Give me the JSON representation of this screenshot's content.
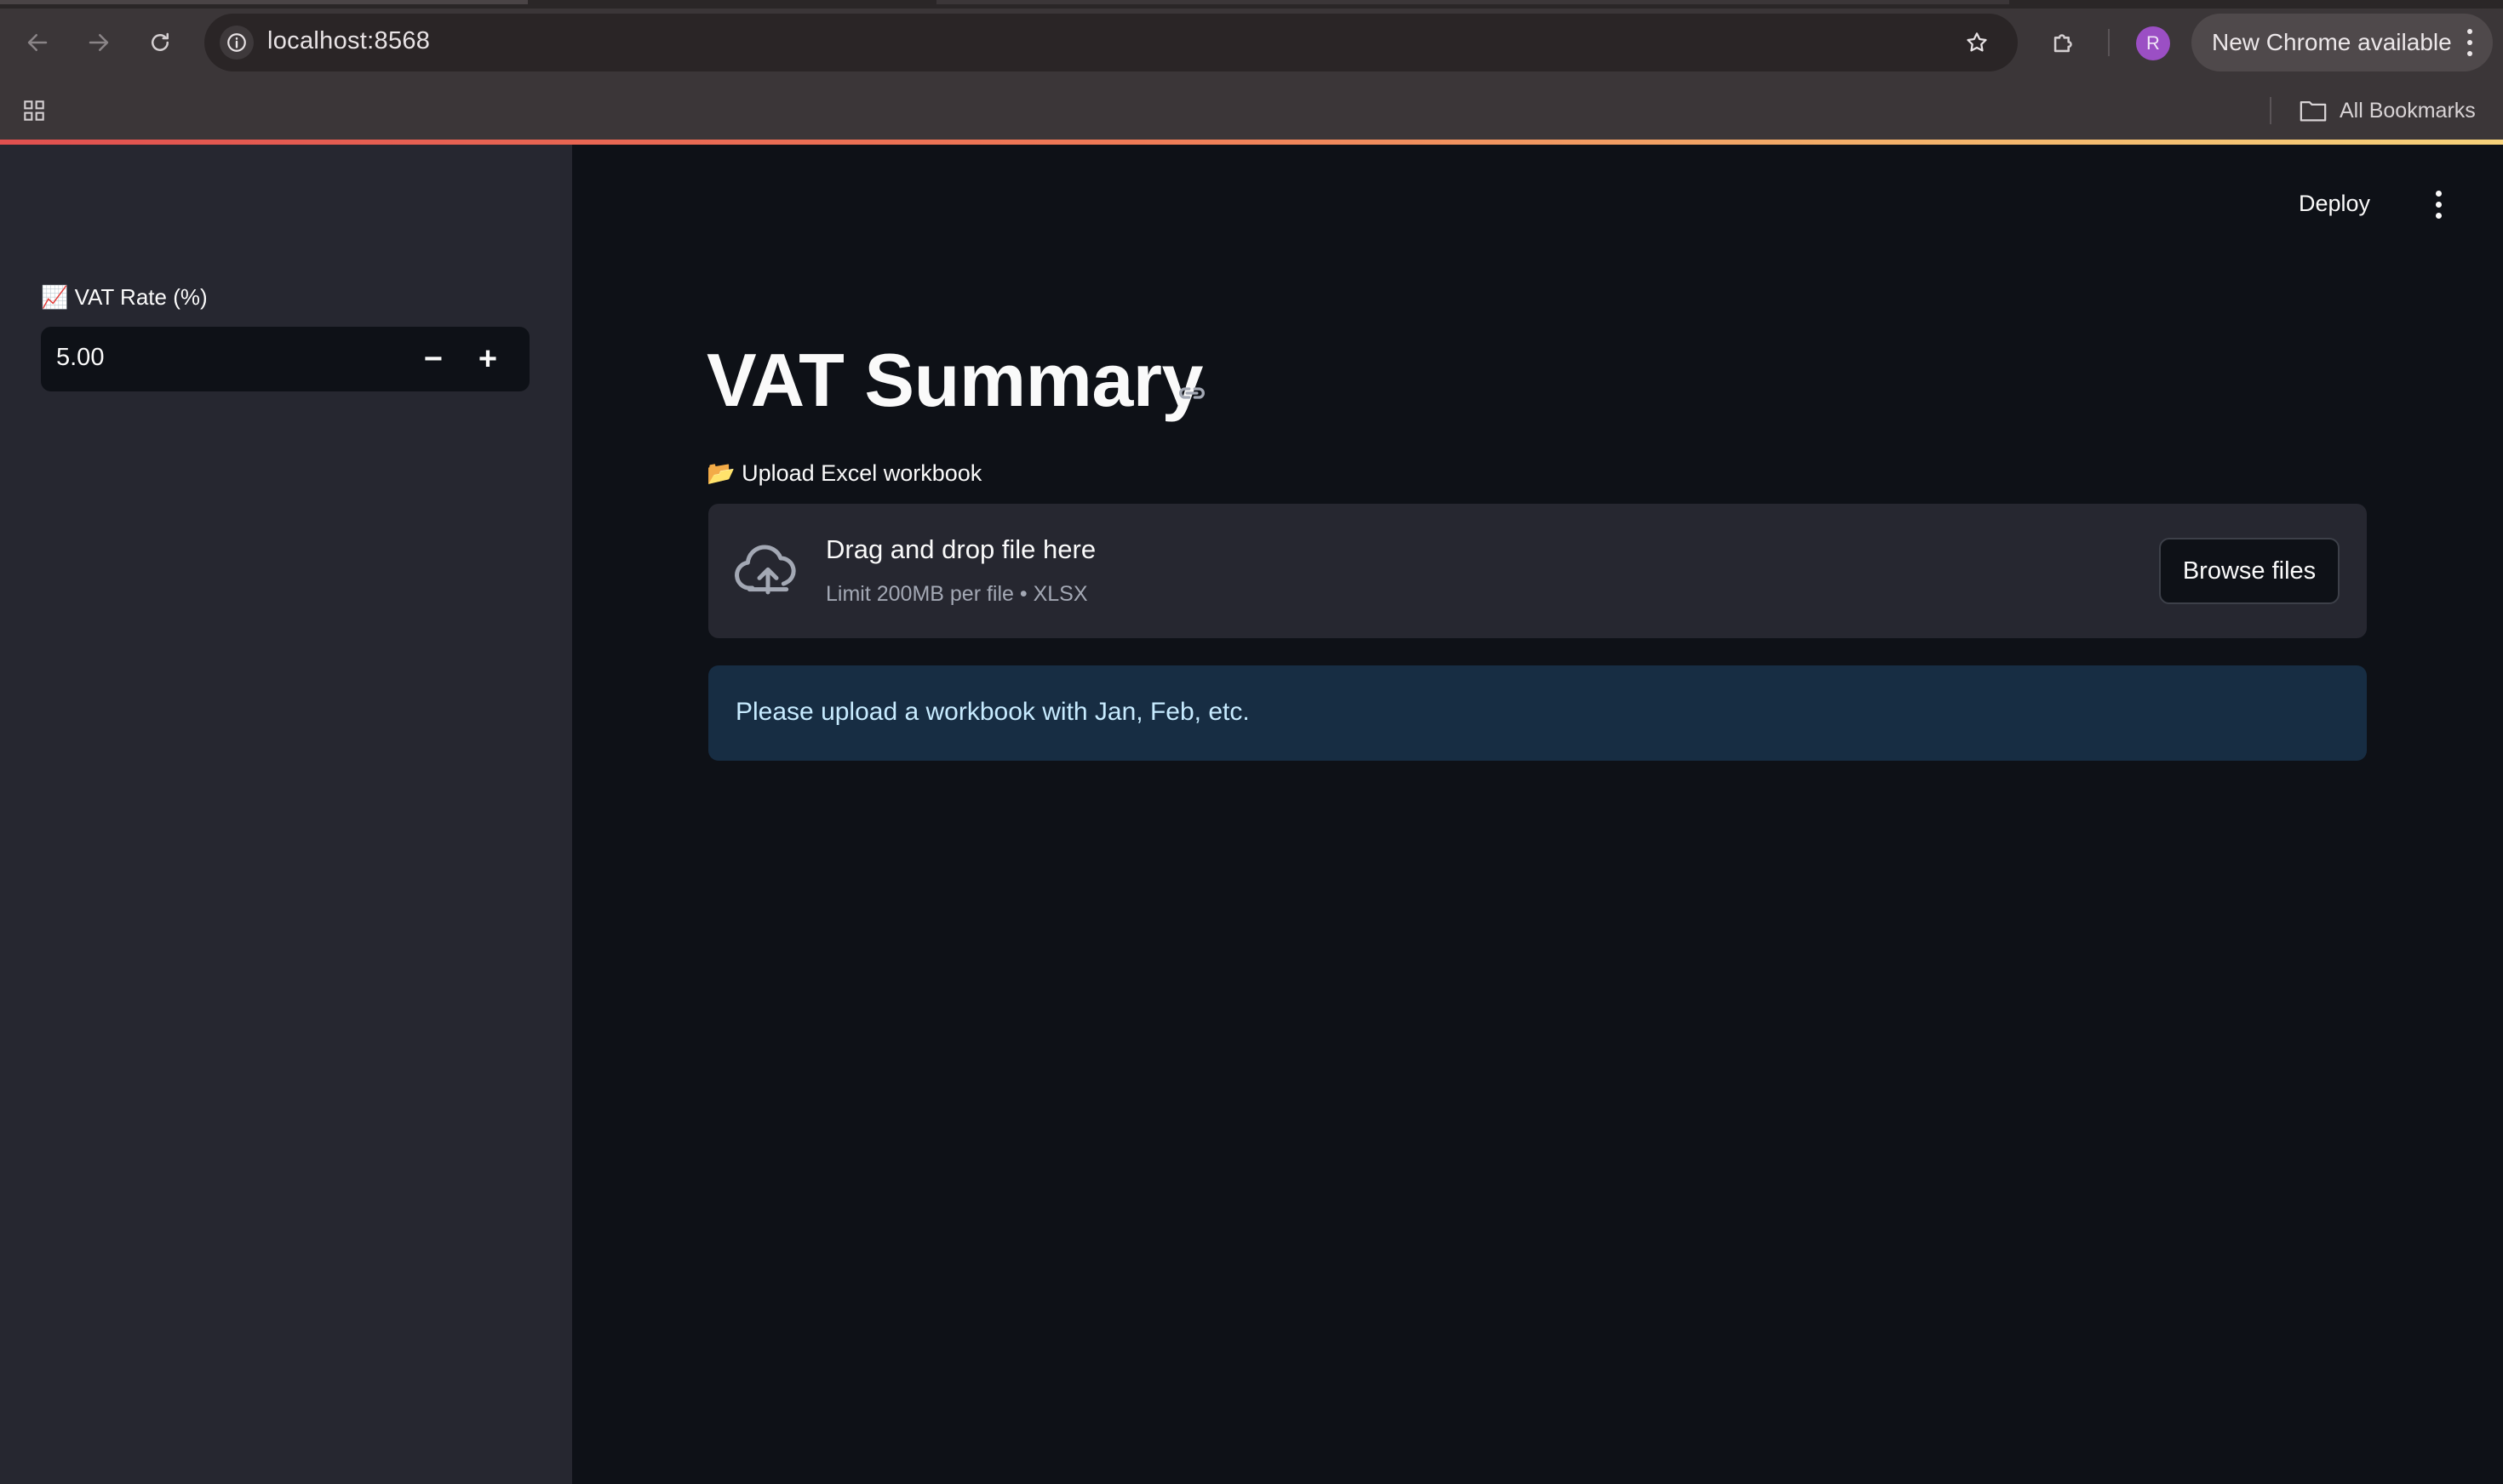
{
  "browser": {
    "url": "localhost:8568",
    "profile_initial": "R",
    "update_label": "New Chrome available",
    "bookmarks_label": "All Bookmarks",
    "icons": [
      "back-icon",
      "forward-icon",
      "reload-icon",
      "info-icon",
      "star-icon",
      "extensions-icon",
      "apps-grid-icon",
      "folder-icon"
    ]
  },
  "sidebar": {
    "vat_label": "📈 VAT Rate (%)",
    "vat_value": "5.00",
    "decrement_symbol": "−",
    "increment_symbol": "+"
  },
  "header": {
    "deploy_label": "Deploy"
  },
  "main": {
    "title": "VAT Summary",
    "upload_label": "📂 Upload Excel workbook",
    "dropzone_title": "Drag and drop file here",
    "dropzone_subtitle": "Limit 200MB per file • XLSX",
    "browse_label": "Browse files",
    "info_message": "Please upload a workbook with Jan, Feb, etc."
  },
  "colors": {
    "app_bg": "#0e1117",
    "sidebar_bg": "#262730",
    "info_bg": "#172d43",
    "info_text": "#c7ebff",
    "chrome_bg": "#3b3638",
    "avatar": "#9b4fc4"
  }
}
